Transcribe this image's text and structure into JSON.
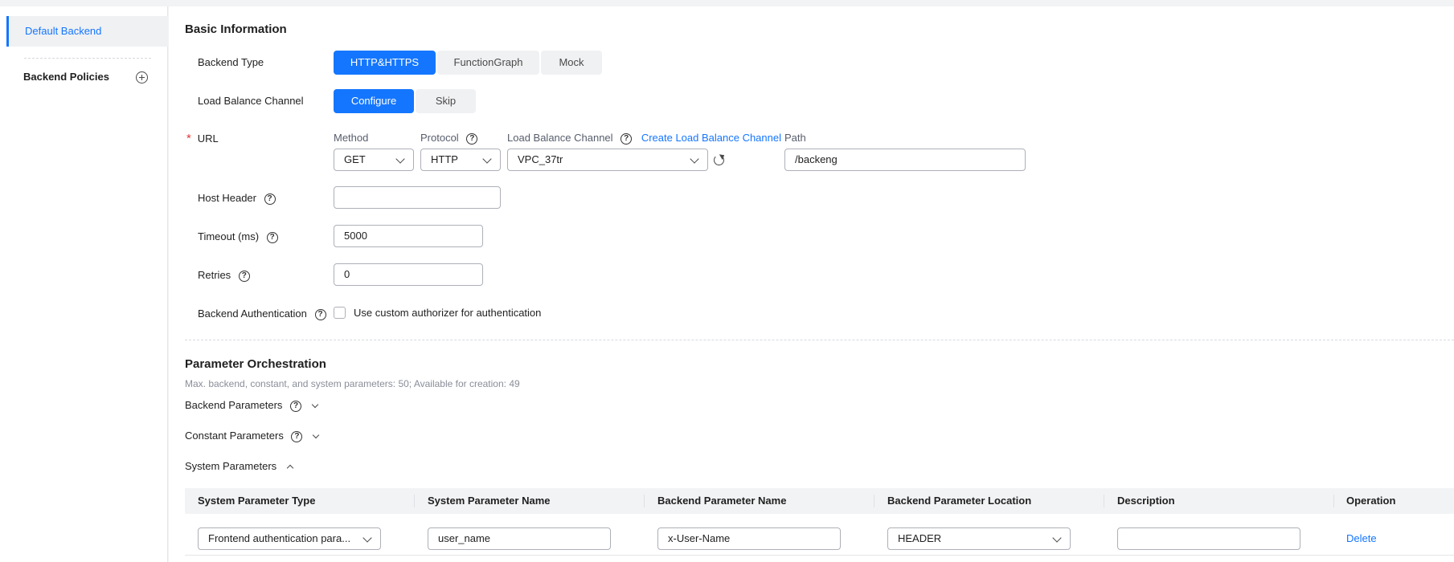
{
  "sidebar": {
    "default_backend": "Default Backend",
    "backend_policies": "Backend Policies"
  },
  "basic": {
    "title": "Basic Information",
    "backend_type_label": "Backend Type",
    "backend_types": [
      "HTTP&HTTPS",
      "FunctionGraph",
      "Mock"
    ],
    "lb_channel_label": "Load Balance Channel",
    "lb_options": [
      "Configure",
      "Skip"
    ],
    "url_label": "URL",
    "method_label": "Method",
    "method_value": "GET",
    "protocol_label": "Protocol",
    "protocol_value": "HTTP",
    "lbc_label": "Load Balance Channel",
    "create_lbc_link": "Create Load Balance Channel",
    "lbc_value": "VPC_37tr",
    "path_label": "Path",
    "path_value": "/backeng",
    "host_header_label": "Host Header",
    "host_header_value": "",
    "timeout_label": "Timeout (ms)",
    "timeout_value": "5000",
    "retries_label": "Retries",
    "retries_value": "0",
    "backend_auth_label": "Backend Authentication",
    "custom_auth_text": "Use custom authorizer for authentication"
  },
  "params": {
    "title": "Parameter Orchestration",
    "hint": "Max. backend, constant, and system parameters: 50; Available for creation: 49",
    "backend_params": "Backend Parameters",
    "constant_params": "Constant Parameters",
    "system_params": "System Parameters",
    "columns": [
      "System Parameter Type",
      "System Parameter Name",
      "Backend Parameter Name",
      "Backend Parameter Location",
      "Description",
      "Operation"
    ],
    "row": {
      "type": "Frontend authentication para...",
      "name": "user_name",
      "backend_name": "x-User-Name",
      "location": "HEADER",
      "description": "",
      "operation": "Delete"
    }
  },
  "colors": {
    "accent": "#1476ff",
    "required": "#e03a3a"
  }
}
